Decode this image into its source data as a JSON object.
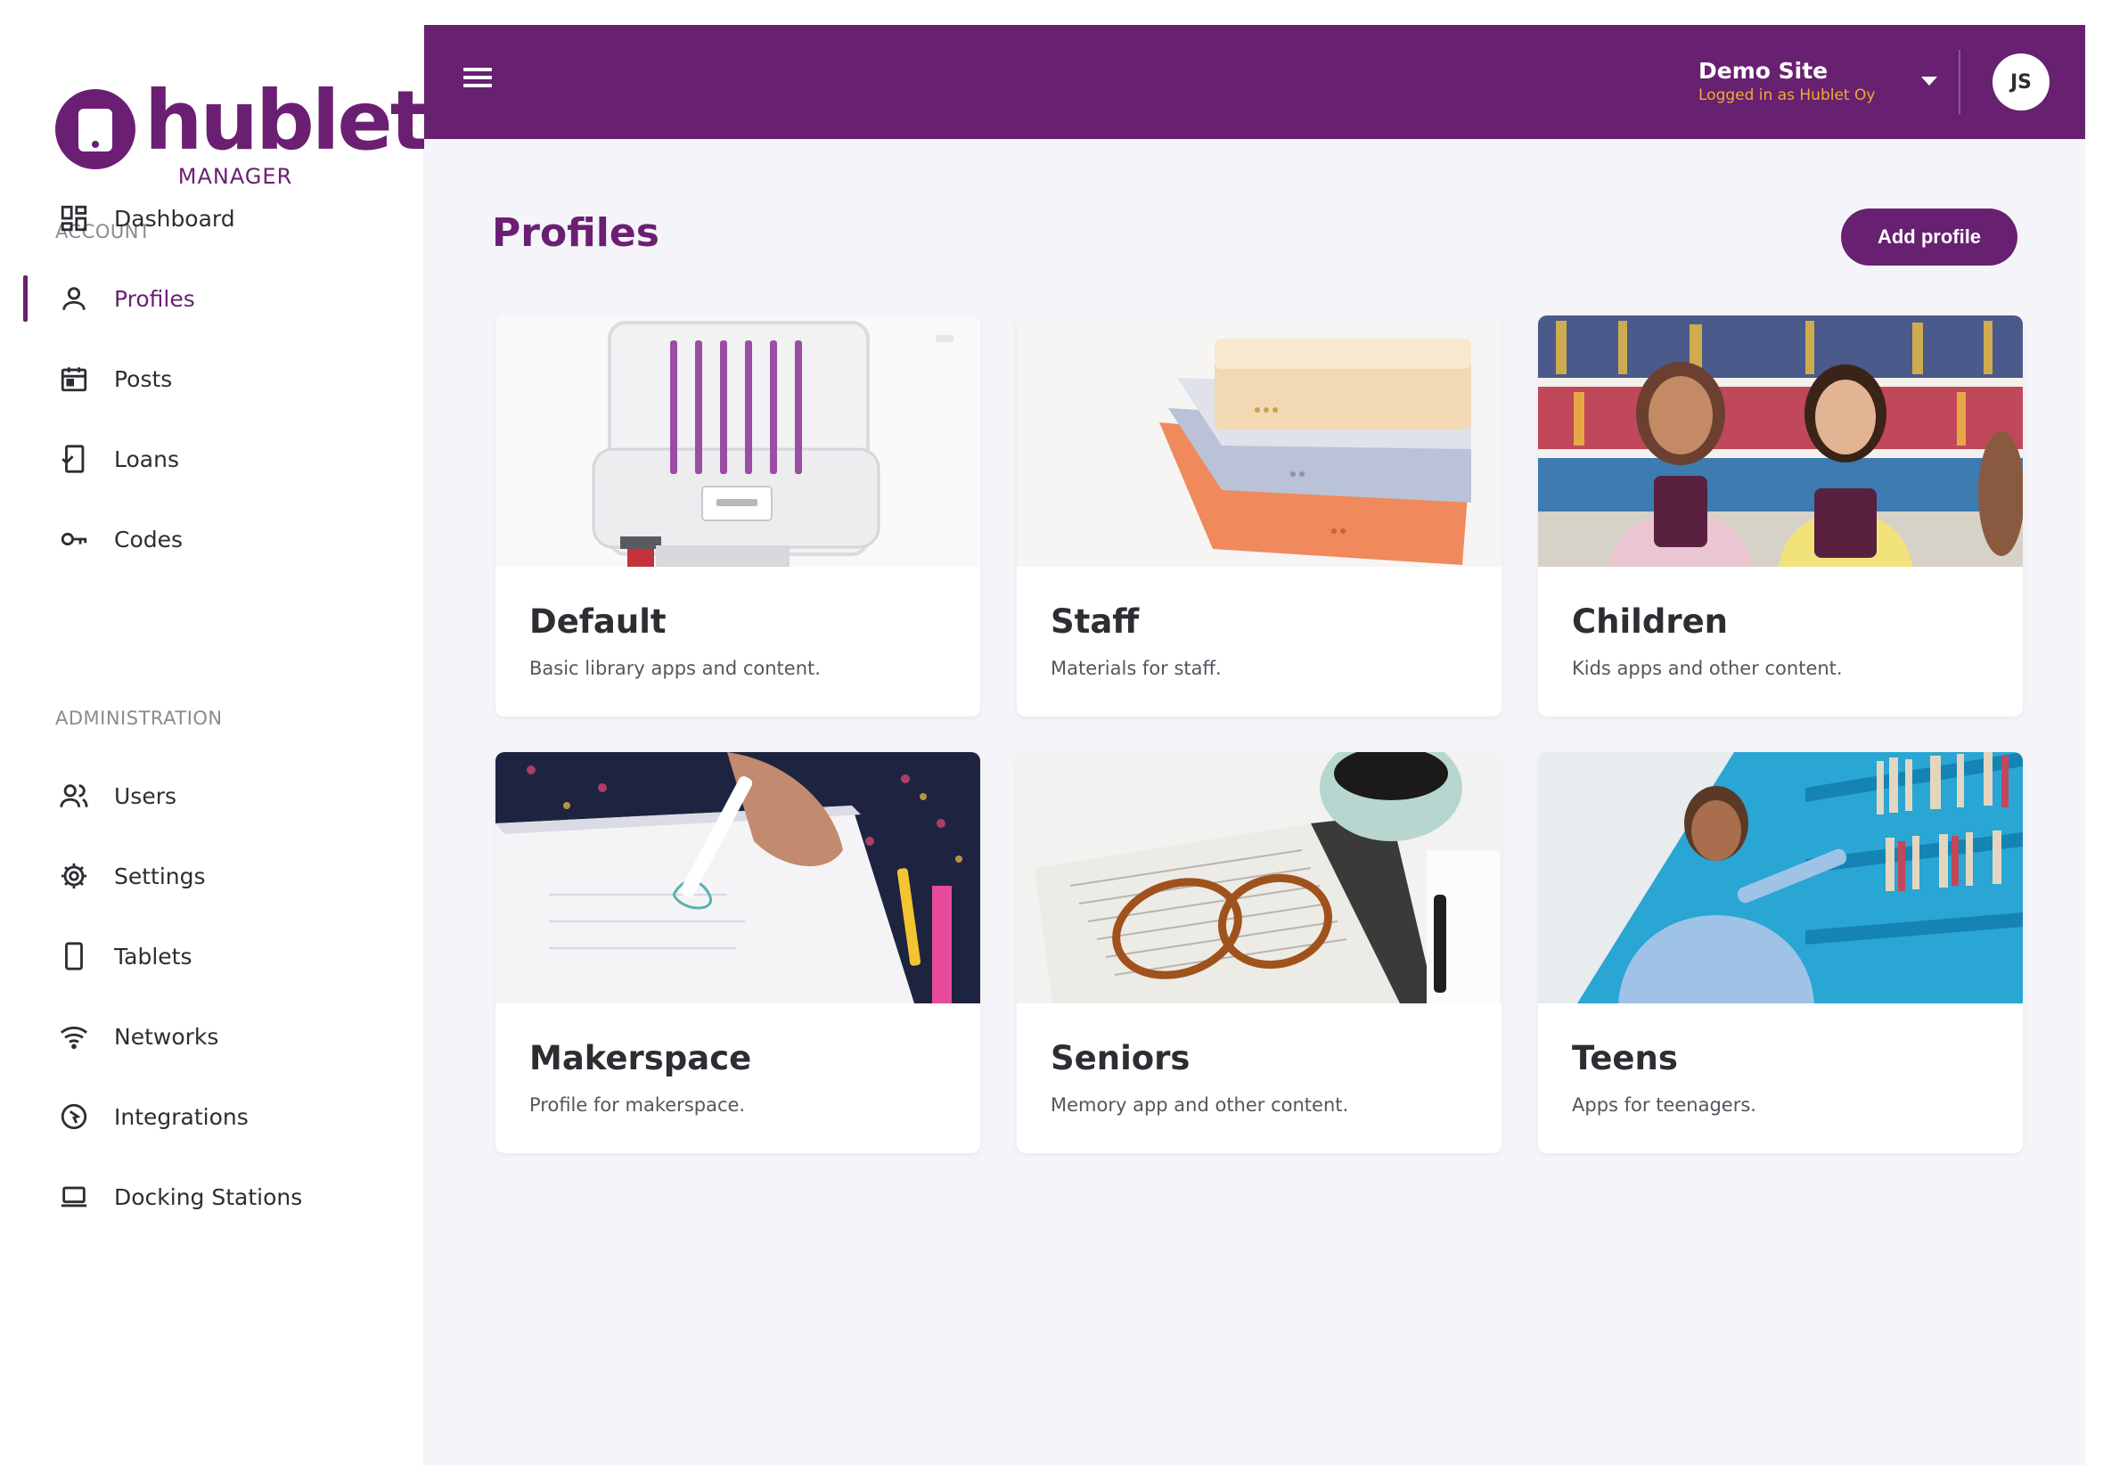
{
  "brand": {
    "name": "hublet",
    "subtitle": "MANAGER",
    "color": "#6b1f73",
    "icon": "tablet-logo-icon"
  },
  "sidebar": {
    "account_label": "ACCOUNT",
    "administration_label": "ADMINISTRATION",
    "active": "Profiles",
    "account_items": [
      {
        "label": "Dashboard",
        "icon": "dashboard-icon"
      },
      {
        "label": "Profiles",
        "icon": "user-icon"
      },
      {
        "label": "Posts",
        "icon": "calendar-icon"
      },
      {
        "label": "Loans",
        "icon": "loan-tablet-icon"
      },
      {
        "label": "Codes",
        "icon": "key-icon"
      }
    ],
    "admin_items": [
      {
        "label": "Users",
        "icon": "users-icon"
      },
      {
        "label": "Settings",
        "icon": "gear-icon"
      },
      {
        "label": "Tablets",
        "icon": "tablet-icon"
      },
      {
        "label": "Networks",
        "icon": "wifi-icon"
      },
      {
        "label": "Integrations",
        "icon": "integration-icon"
      },
      {
        "label": "Docking Stations",
        "icon": "laptop-icon"
      }
    ]
  },
  "header": {
    "menu_icon": "hamburger-icon",
    "site_name": "Demo Site",
    "logged_in_as": "Logged in as Hublet Oy",
    "avatar_initials": "JS",
    "bar_color": "#672170"
  },
  "main": {
    "title": "Profiles",
    "add_button": "Add profile",
    "profiles": [
      {
        "name": "Default",
        "description": "Basic library apps and content."
      },
      {
        "name": "Staff",
        "description": "Materials for staff."
      },
      {
        "name": "Children",
        "description": "Kids apps and other content."
      },
      {
        "name": "Makerspace",
        "description": "Profile for makerspace."
      },
      {
        "name": "Seniors",
        "description": "Memory app and other content."
      },
      {
        "name": "Teens",
        "description": "Apps for teenagers."
      }
    ]
  }
}
